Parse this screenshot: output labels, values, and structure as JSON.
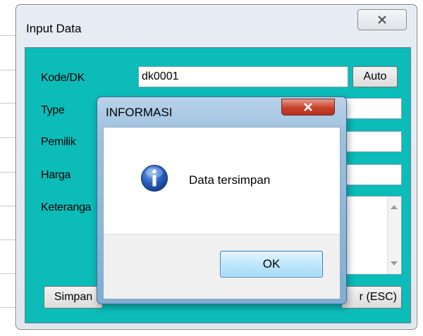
{
  "window": {
    "title": "Input Data",
    "close_glyph": "✕"
  },
  "form": {
    "kode_label": "Kode/DK",
    "kode_value": "dk0001",
    "auto_button": "Auto",
    "type_label": "Type",
    "pemilik_label": "Pemilik",
    "harga_label": "Harga",
    "keterangan_label": "Keteranga",
    "simpan_button": "Simpan",
    "keluar_button": "r (ESC)"
  },
  "dialog": {
    "title": "INFORMASI",
    "close_glyph": "✕",
    "message": "Data tersimpan",
    "ok_button": "OK",
    "icon": "info-icon"
  },
  "colors": {
    "client_bg": "#0bbcb8",
    "dialog_close": "#c6412a"
  }
}
